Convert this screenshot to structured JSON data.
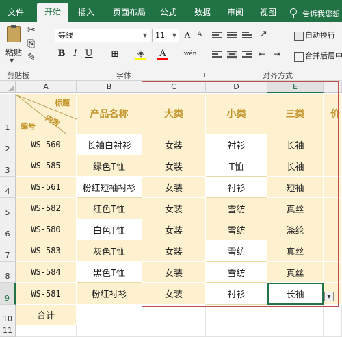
{
  "ribbon_tabs": [
    {
      "label": "文件",
      "active": false
    },
    {
      "label": "开始",
      "active": true
    },
    {
      "label": "插入",
      "active": false
    },
    {
      "label": "页面布局",
      "active": false
    },
    {
      "label": "公式",
      "active": false
    },
    {
      "label": "数据",
      "active": false
    },
    {
      "label": "审阅",
      "active": false
    },
    {
      "label": "视图",
      "active": false
    }
  ],
  "tell_me": "告诉我您想",
  "clipboard": {
    "paste_label": "粘贴",
    "group_label": "剪贴板"
  },
  "font": {
    "font_name": "等线",
    "font_size": "11",
    "bold": "B",
    "italic": "I",
    "underline": "U",
    "font_color_label": "A",
    "phonetic_label": "wén",
    "group_label": "字体"
  },
  "alignment": {
    "wrap_text": "自动换行",
    "merge_center": "合并后居中",
    "group_label": "对齐方式"
  },
  "sheet": {
    "columns": [
      "A",
      "B",
      "C",
      "D",
      "E"
    ],
    "rows": [
      "1",
      "2",
      "3",
      "4",
      "5",
      "6",
      "7",
      "8",
      "9",
      "10",
      "11"
    ],
    "diagonal_header": {
      "top": "标题",
      "middle": "内容",
      "bottom": "编号"
    },
    "headers": [
      "产品名称",
      "大类",
      "小类",
      "三类",
      "价"
    ],
    "data": [
      [
        "WS-560",
        "长袖白衬衫",
        "女装",
        "衬衫",
        "长袖"
      ],
      [
        "WS-585",
        "绿色T恤",
        "女装",
        "T恤",
        "长袖"
      ],
      [
        "WS-561",
        "粉红短袖衬衫",
        "女装",
        "衬衫",
        "短袖"
      ],
      [
        "WS-582",
        "红色T恤",
        "女装",
        "雪纺",
        "真丝"
      ],
      [
        "WS-580",
        "白色T恤",
        "女装",
        "雪纺",
        "涤纶"
      ],
      [
        "WS-583",
        "灰色T恤",
        "女装",
        "雪纺",
        "真丝"
      ],
      [
        "WS-584",
        "黑色T恤",
        "女装",
        "雪纺",
        "真丝"
      ],
      [
        "WS-581",
        "粉红衬衫",
        "女装",
        "衬衫",
        "长袖"
      ]
    ],
    "total_label": "合计",
    "selected_column": "E",
    "selected_row": "9"
  },
  "colors": {
    "ribbon_green": "#217346",
    "cell_fill": "#fdf1cf",
    "header_text": "#c2942a",
    "selection_border": "#c0504d"
  }
}
